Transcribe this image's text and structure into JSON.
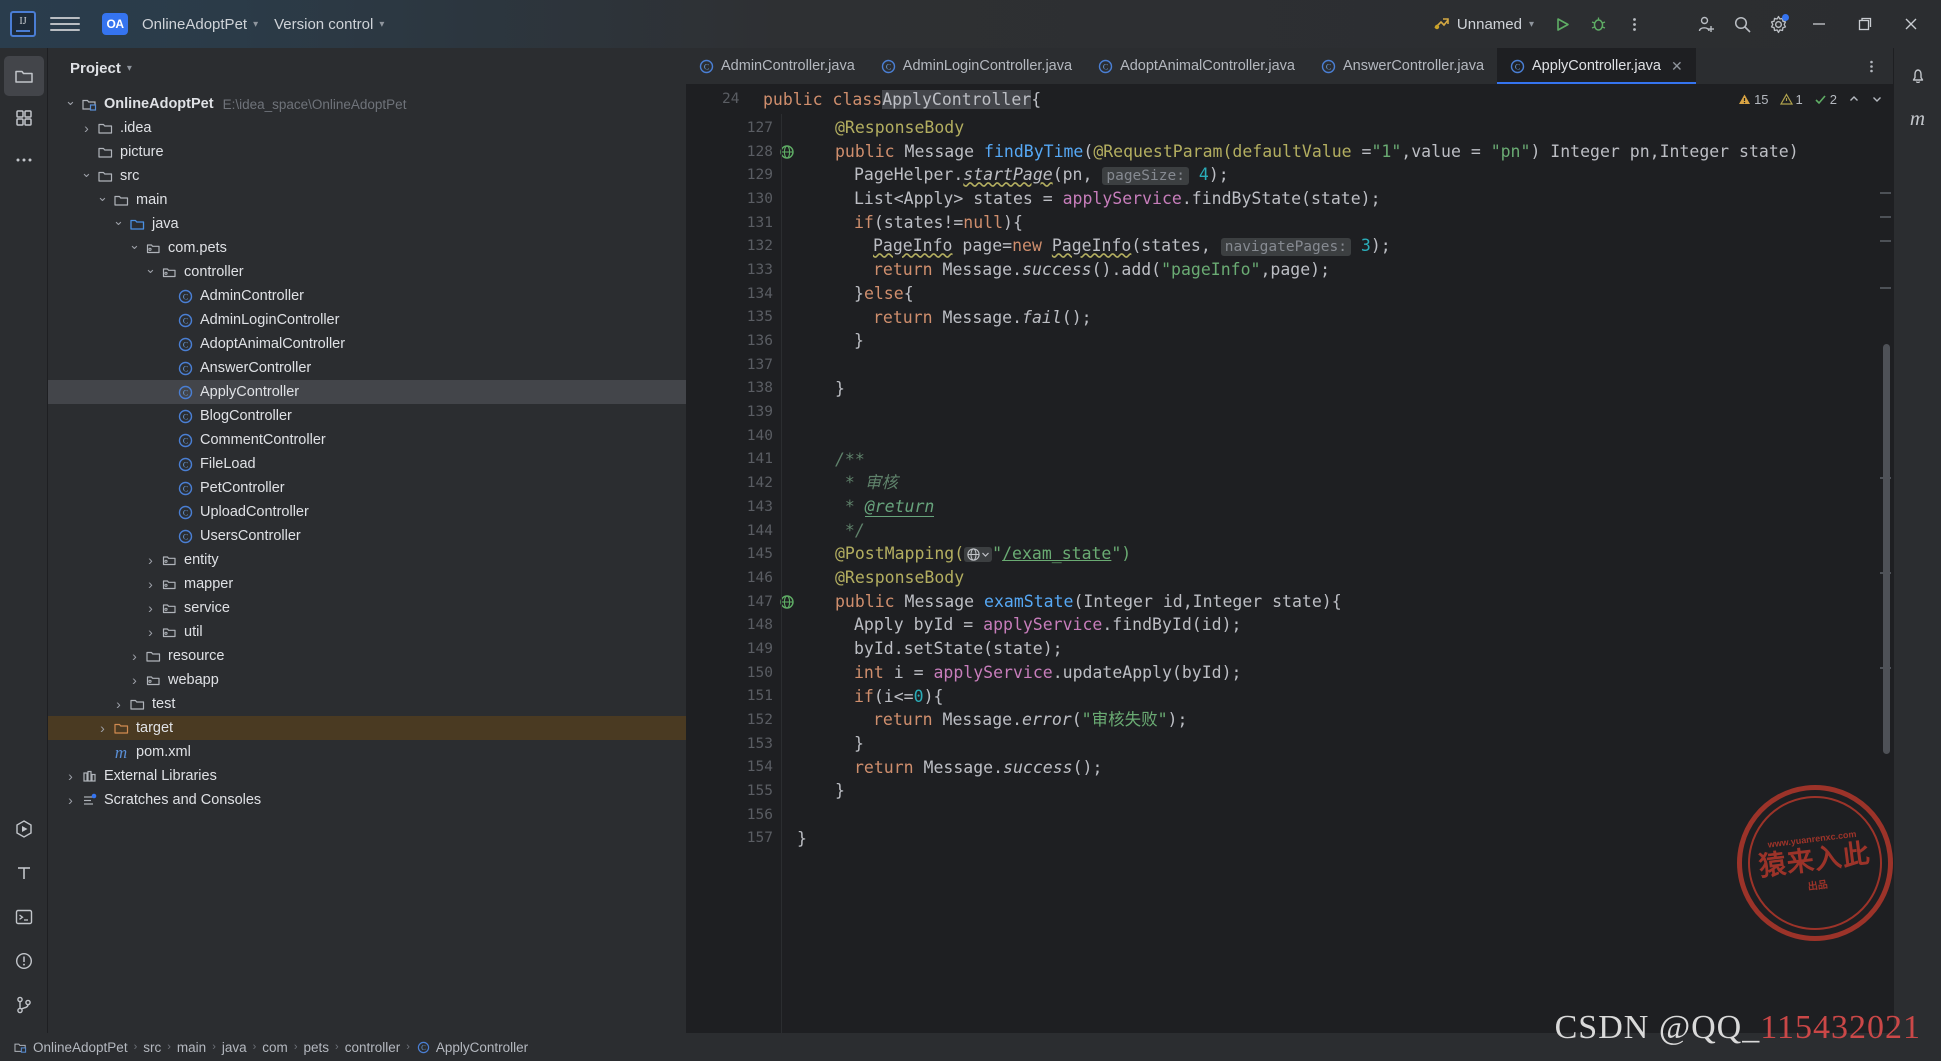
{
  "titlebar": {
    "logo_alt": "IJ",
    "project_badge": "OA",
    "project_name": "OnlineAdoptPet",
    "version_control": "Version control",
    "run_config": "Unnamed",
    "icons": {
      "menu": "hamburger-icon",
      "run": "run-icon",
      "debug": "debug-icon",
      "more": "more-vertical-icon",
      "add_user": "add-user-icon",
      "search": "search-icon",
      "settings": "settings-icon",
      "minimize": "minimize-icon",
      "maximize": "maximize-icon",
      "close": "close-icon"
    }
  },
  "project_panel": {
    "title": "Project",
    "tree": [
      {
        "label": "OnlineAdoptPet",
        "path": "E:\\idea_space\\OnlineAdoptPet",
        "indent": 0,
        "twisty": "down",
        "icon": "module-icon",
        "bold": true
      },
      {
        "label": ".idea",
        "indent": 1,
        "twisty": "right",
        "icon": "folder-icon"
      },
      {
        "label": "picture",
        "indent": 1,
        "twisty": "none",
        "icon": "folder-icon"
      },
      {
        "label": "src",
        "indent": 1,
        "twisty": "down",
        "icon": "folder-icon"
      },
      {
        "label": "main",
        "indent": 2,
        "twisty": "down",
        "icon": "folder-icon"
      },
      {
        "label": "java",
        "indent": 3,
        "twisty": "down",
        "icon": "source-folder-icon"
      },
      {
        "label": "com.pets",
        "indent": 4,
        "twisty": "down",
        "icon": "package-icon"
      },
      {
        "label": "controller",
        "indent": 5,
        "twisty": "down",
        "icon": "package-icon"
      },
      {
        "label": "AdminController",
        "indent": 6,
        "twisty": "none",
        "icon": "class-icon"
      },
      {
        "label": "AdminLoginController",
        "indent": 6,
        "twisty": "none",
        "icon": "class-icon"
      },
      {
        "label": "AdoptAnimalController",
        "indent": 6,
        "twisty": "none",
        "icon": "class-icon"
      },
      {
        "label": "AnswerController",
        "indent": 6,
        "twisty": "none",
        "icon": "class-icon"
      },
      {
        "label": "ApplyController",
        "indent": 6,
        "twisty": "none",
        "icon": "class-icon",
        "selected": true
      },
      {
        "label": "BlogController",
        "indent": 6,
        "twisty": "none",
        "icon": "class-icon"
      },
      {
        "label": "CommentController",
        "indent": 6,
        "twisty": "none",
        "icon": "class-icon"
      },
      {
        "label": "FileLoad",
        "indent": 6,
        "twisty": "none",
        "icon": "class-icon"
      },
      {
        "label": "PetController",
        "indent": 6,
        "twisty": "none",
        "icon": "class-icon"
      },
      {
        "label": "UploadController",
        "indent": 6,
        "twisty": "none",
        "icon": "class-icon"
      },
      {
        "label": "UsersController",
        "indent": 6,
        "twisty": "none",
        "icon": "class-icon"
      },
      {
        "label": "entity",
        "indent": 5,
        "twisty": "right",
        "icon": "package-icon"
      },
      {
        "label": "mapper",
        "indent": 5,
        "twisty": "right",
        "icon": "package-icon"
      },
      {
        "label": "service",
        "indent": 5,
        "twisty": "right",
        "icon": "package-icon"
      },
      {
        "label": "util",
        "indent": 5,
        "twisty": "right",
        "icon": "package-icon"
      },
      {
        "label": "resource",
        "indent": 4,
        "twisty": "right",
        "icon": "folder-icon"
      },
      {
        "label": "webapp",
        "indent": 4,
        "twisty": "right",
        "icon": "package-icon"
      },
      {
        "label": "test",
        "indent": 3,
        "twisty": "right",
        "icon": "folder-icon"
      },
      {
        "label": "target",
        "indent": 2,
        "twisty": "right",
        "icon": "folder-excluded-icon",
        "target_highlight": true
      },
      {
        "label": "pom.xml",
        "indent": 2,
        "twisty": "none",
        "icon": "maven-icon"
      },
      {
        "label": "External Libraries",
        "indent": 0,
        "twisty": "right",
        "icon": "libraries-icon"
      },
      {
        "label": "Scratches and Consoles",
        "indent": 0,
        "twisty": "right",
        "icon": "scratches-icon"
      }
    ]
  },
  "editor": {
    "tabs": [
      {
        "label": "AdminController.java",
        "active": false
      },
      {
        "label": "AdminLoginController.java",
        "active": false
      },
      {
        "label": "AdoptAnimalController.java",
        "active": false
      },
      {
        "label": "AnswerController.java",
        "active": false
      },
      {
        "label": "ApplyController.java",
        "active": true,
        "closeable": true
      }
    ],
    "tabs_more_icon": "more-vertical-icon",
    "sticky_line_number": "24",
    "sticky_code_prefix": "public class ",
    "sticky_code_class": "ApplyController",
    "sticky_code_suffix": " {",
    "inspections": {
      "warnings": "15",
      "weak_warnings": "1",
      "checks": "2",
      "up_icon": "chevron-up-icon",
      "down_icon": "chevron-down-icon",
      "warning_icon": "warning-triangle-icon",
      "weak_warning_icon": "weak-warning-icon",
      "ok_icon": "check-icon"
    },
    "first_line_number": 127,
    "lines": [
      {
        "n": "127",
        "indent": 2,
        "tokens": [
          {
            "t": "@ResponseBody",
            "c": "ann"
          }
        ]
      },
      {
        "n": "128",
        "gutter_icon": "web-mapping-icon",
        "indent": 2,
        "tokens": [
          {
            "t": "public ",
            "c": "kw"
          },
          {
            "t": "Message ",
            "c": "id"
          },
          {
            "t": "findByTime",
            "c": "mth"
          },
          {
            "t": "(",
            "c": "id"
          },
          {
            "t": "@RequestParam",
            "c": "ann"
          },
          {
            "t": "(",
            "c": "ann"
          },
          {
            "t": "defaultValue ",
            "c": "ann"
          },
          {
            "t": "=",
            "c": "id"
          },
          {
            "t": "\"1\"",
            "c": "str"
          },
          {
            "t": ",value = ",
            "c": "id"
          },
          {
            "t": "\"pn\"",
            "c": "str"
          },
          {
            "t": ") Integer pn,Integer state)",
            "c": "id"
          }
        ]
      },
      {
        "n": "129",
        "indent": 3,
        "tokens": [
          {
            "t": "PageHelper.",
            "c": "id"
          },
          {
            "t": "startPage",
            "c": "italu"
          },
          {
            "t": "(pn, ",
            "c": "id"
          },
          {
            "t": "pageSize:",
            "c": "hint"
          },
          {
            "t": " ",
            "c": "id"
          },
          {
            "t": "4",
            "c": "num"
          },
          {
            "t": ");",
            "c": "id"
          }
        ]
      },
      {
        "n": "130",
        "indent": 3,
        "tokens": [
          {
            "t": "List<Apply> states = ",
            "c": "id"
          },
          {
            "t": "applyService",
            "c": "fld"
          },
          {
            "t": ".findByState(state);",
            "c": "id"
          }
        ]
      },
      {
        "n": "131",
        "indent": 3,
        "tokens": [
          {
            "t": "if",
            "c": "kw"
          },
          {
            "t": "(states!=",
            "c": "id"
          },
          {
            "t": "null",
            "c": "kw"
          },
          {
            "t": "){",
            "c": "id"
          }
        ]
      },
      {
        "n": "132",
        "indent": 4,
        "tokens": [
          {
            "t": "PageInfo",
            "c": "italu2"
          },
          {
            "t": " page=",
            "c": "id"
          },
          {
            "t": "new ",
            "c": "kw"
          },
          {
            "t": "PageInfo",
            "c": "italu2"
          },
          {
            "t": "(states, ",
            "c": "id"
          },
          {
            "t": "navigatePages:",
            "c": "hint"
          },
          {
            "t": " ",
            "c": "id"
          },
          {
            "t": "3",
            "c": "num"
          },
          {
            "t": ");",
            "c": "id"
          }
        ]
      },
      {
        "n": "133",
        "indent": 4,
        "tokens": [
          {
            "t": "return ",
            "c": "kw"
          },
          {
            "t": "Message.",
            "c": "id"
          },
          {
            "t": "success",
            "c": "ital"
          },
          {
            "t": "().add(",
            "c": "id"
          },
          {
            "t": "\"pageInfo\"",
            "c": "str"
          },
          {
            "t": ",page);",
            "c": "id"
          }
        ]
      },
      {
        "n": "134",
        "indent": 3,
        "tokens": [
          {
            "t": "}",
            "c": "id"
          },
          {
            "t": "else",
            "c": "kw"
          },
          {
            "t": "{",
            "c": "id"
          }
        ]
      },
      {
        "n": "135",
        "indent": 4,
        "tokens": [
          {
            "t": "return ",
            "c": "kw"
          },
          {
            "t": "Message.",
            "c": "id"
          },
          {
            "t": "fail",
            "c": "ital"
          },
          {
            "t": "();",
            "c": "id"
          }
        ]
      },
      {
        "n": "136",
        "indent": 3,
        "tokens": [
          {
            "t": "}",
            "c": "id"
          }
        ]
      },
      {
        "n": "137",
        "indent": 0,
        "tokens": []
      },
      {
        "n": "138",
        "indent": 2,
        "tokens": [
          {
            "t": "}",
            "c": "id"
          }
        ]
      },
      {
        "n": "139",
        "indent": 0,
        "tokens": []
      },
      {
        "n": "140",
        "indent": 0,
        "tokens": []
      },
      {
        "n": "141",
        "indent": 2,
        "tokens": [
          {
            "t": "/**",
            "c": "doc"
          }
        ]
      },
      {
        "n": "142",
        "indent": 2,
        "tokens": [
          {
            "t": " * ",
            "c": "doc"
          },
          {
            "t": "审核",
            "c": "doc"
          }
        ]
      },
      {
        "n": "143",
        "indent": 2,
        "tokens": [
          {
            "t": " * ",
            "c": "doc"
          },
          {
            "t": "@return",
            "c": "doctag"
          }
        ]
      },
      {
        "n": "144",
        "indent": 2,
        "tokens": [
          {
            "t": " */",
            "c": "doc"
          }
        ]
      },
      {
        "n": "145",
        "indent": 2,
        "tokens": [
          {
            "t": "@PostMapping",
            "c": "ann"
          },
          {
            "t": "(",
            "c": "ann"
          },
          {
            "t": "globe",
            "c": "globeicon"
          },
          {
            "t": "\"",
            "c": "str"
          },
          {
            "t": "/exam_state",
            "c": "ulink"
          },
          {
            "t": "\")",
            "c": "str"
          }
        ]
      },
      {
        "n": "146",
        "indent": 2,
        "tokens": [
          {
            "t": "@ResponseBody",
            "c": "ann"
          }
        ]
      },
      {
        "n": "147",
        "gutter_icon": "web-mapping-icon",
        "indent": 2,
        "tokens": [
          {
            "t": "public ",
            "c": "kw"
          },
          {
            "t": "Message ",
            "c": "id"
          },
          {
            "t": "examState",
            "c": "mth"
          },
          {
            "t": "(Integer id,Integer state){",
            "c": "id"
          }
        ]
      },
      {
        "n": "148",
        "indent": 3,
        "tokens": [
          {
            "t": "Apply byId = ",
            "c": "id"
          },
          {
            "t": "applyService",
            "c": "fld"
          },
          {
            "t": ".findById(id);",
            "c": "id"
          }
        ]
      },
      {
        "n": "149",
        "indent": 3,
        "tokens": [
          {
            "t": "byId.setState(state);",
            "c": "id"
          }
        ]
      },
      {
        "n": "150",
        "indent": 3,
        "tokens": [
          {
            "t": "int ",
            "c": "kw"
          },
          {
            "t": "i = ",
            "c": "id"
          },
          {
            "t": "applyService",
            "c": "fld"
          },
          {
            "t": ".updateApply(byId);",
            "c": "id"
          }
        ]
      },
      {
        "n": "151",
        "indent": 3,
        "tokens": [
          {
            "t": "if",
            "c": "kw"
          },
          {
            "t": "(i<=",
            "c": "id"
          },
          {
            "t": "0",
            "c": "num"
          },
          {
            "t": "){",
            "c": "id"
          }
        ]
      },
      {
        "n": "152",
        "indent": 4,
        "tokens": [
          {
            "t": "return ",
            "c": "kw"
          },
          {
            "t": "Message.",
            "c": "id"
          },
          {
            "t": "error",
            "c": "ital"
          },
          {
            "t": "(",
            "c": "id"
          },
          {
            "t": "\"审核失败\"",
            "c": "str"
          },
          {
            "t": ");",
            "c": "id"
          }
        ]
      },
      {
        "n": "153",
        "indent": 3,
        "tokens": [
          {
            "t": "}",
            "c": "id"
          }
        ]
      },
      {
        "n": "154",
        "indent": 3,
        "tokens": [
          {
            "t": "return ",
            "c": "kw"
          },
          {
            "t": "Message.",
            "c": "id"
          },
          {
            "t": "success",
            "c": "ital"
          },
          {
            "t": "();",
            "c": "id"
          }
        ]
      },
      {
        "n": "155",
        "indent": 2,
        "tokens": [
          {
            "t": "}",
            "c": "id"
          }
        ]
      },
      {
        "n": "156",
        "indent": 0,
        "tokens": []
      },
      {
        "n": "157",
        "indent": 0,
        "tokens": [
          {
            "t": "}",
            "c": "id"
          }
        ]
      }
    ]
  },
  "statusbar": {
    "crumbs": [
      {
        "label": "OnlineAdoptPet",
        "icon": "module-icon"
      },
      {
        "label": "src",
        "icon": "none"
      },
      {
        "label": "main",
        "icon": "none"
      },
      {
        "label": "java",
        "icon": "none"
      },
      {
        "label": "com",
        "icon": "none"
      },
      {
        "label": "pets",
        "icon": "none"
      },
      {
        "label": "controller",
        "icon": "none"
      },
      {
        "label": "ApplyController",
        "icon": "class-icon"
      }
    ]
  },
  "overlay": {
    "stamp_line1": "猿来入此",
    "stamp_top": "www.yuanrenxc.com",
    "stamp_bottom": "出品",
    "csdn_text": "CSDN @QQ_",
    "csdn_number": "115432021"
  },
  "colors": {
    "accent": "#3574f0",
    "keyword": "#cf8e6d",
    "string": "#6aab73",
    "annotation": "#b3ae60",
    "method": "#56a8f5",
    "field": "#c77dbb",
    "number": "#2aacb8",
    "comment": "#5f826b",
    "bg_editor": "#1e1f22",
    "bg_panel": "#2b2d30"
  }
}
